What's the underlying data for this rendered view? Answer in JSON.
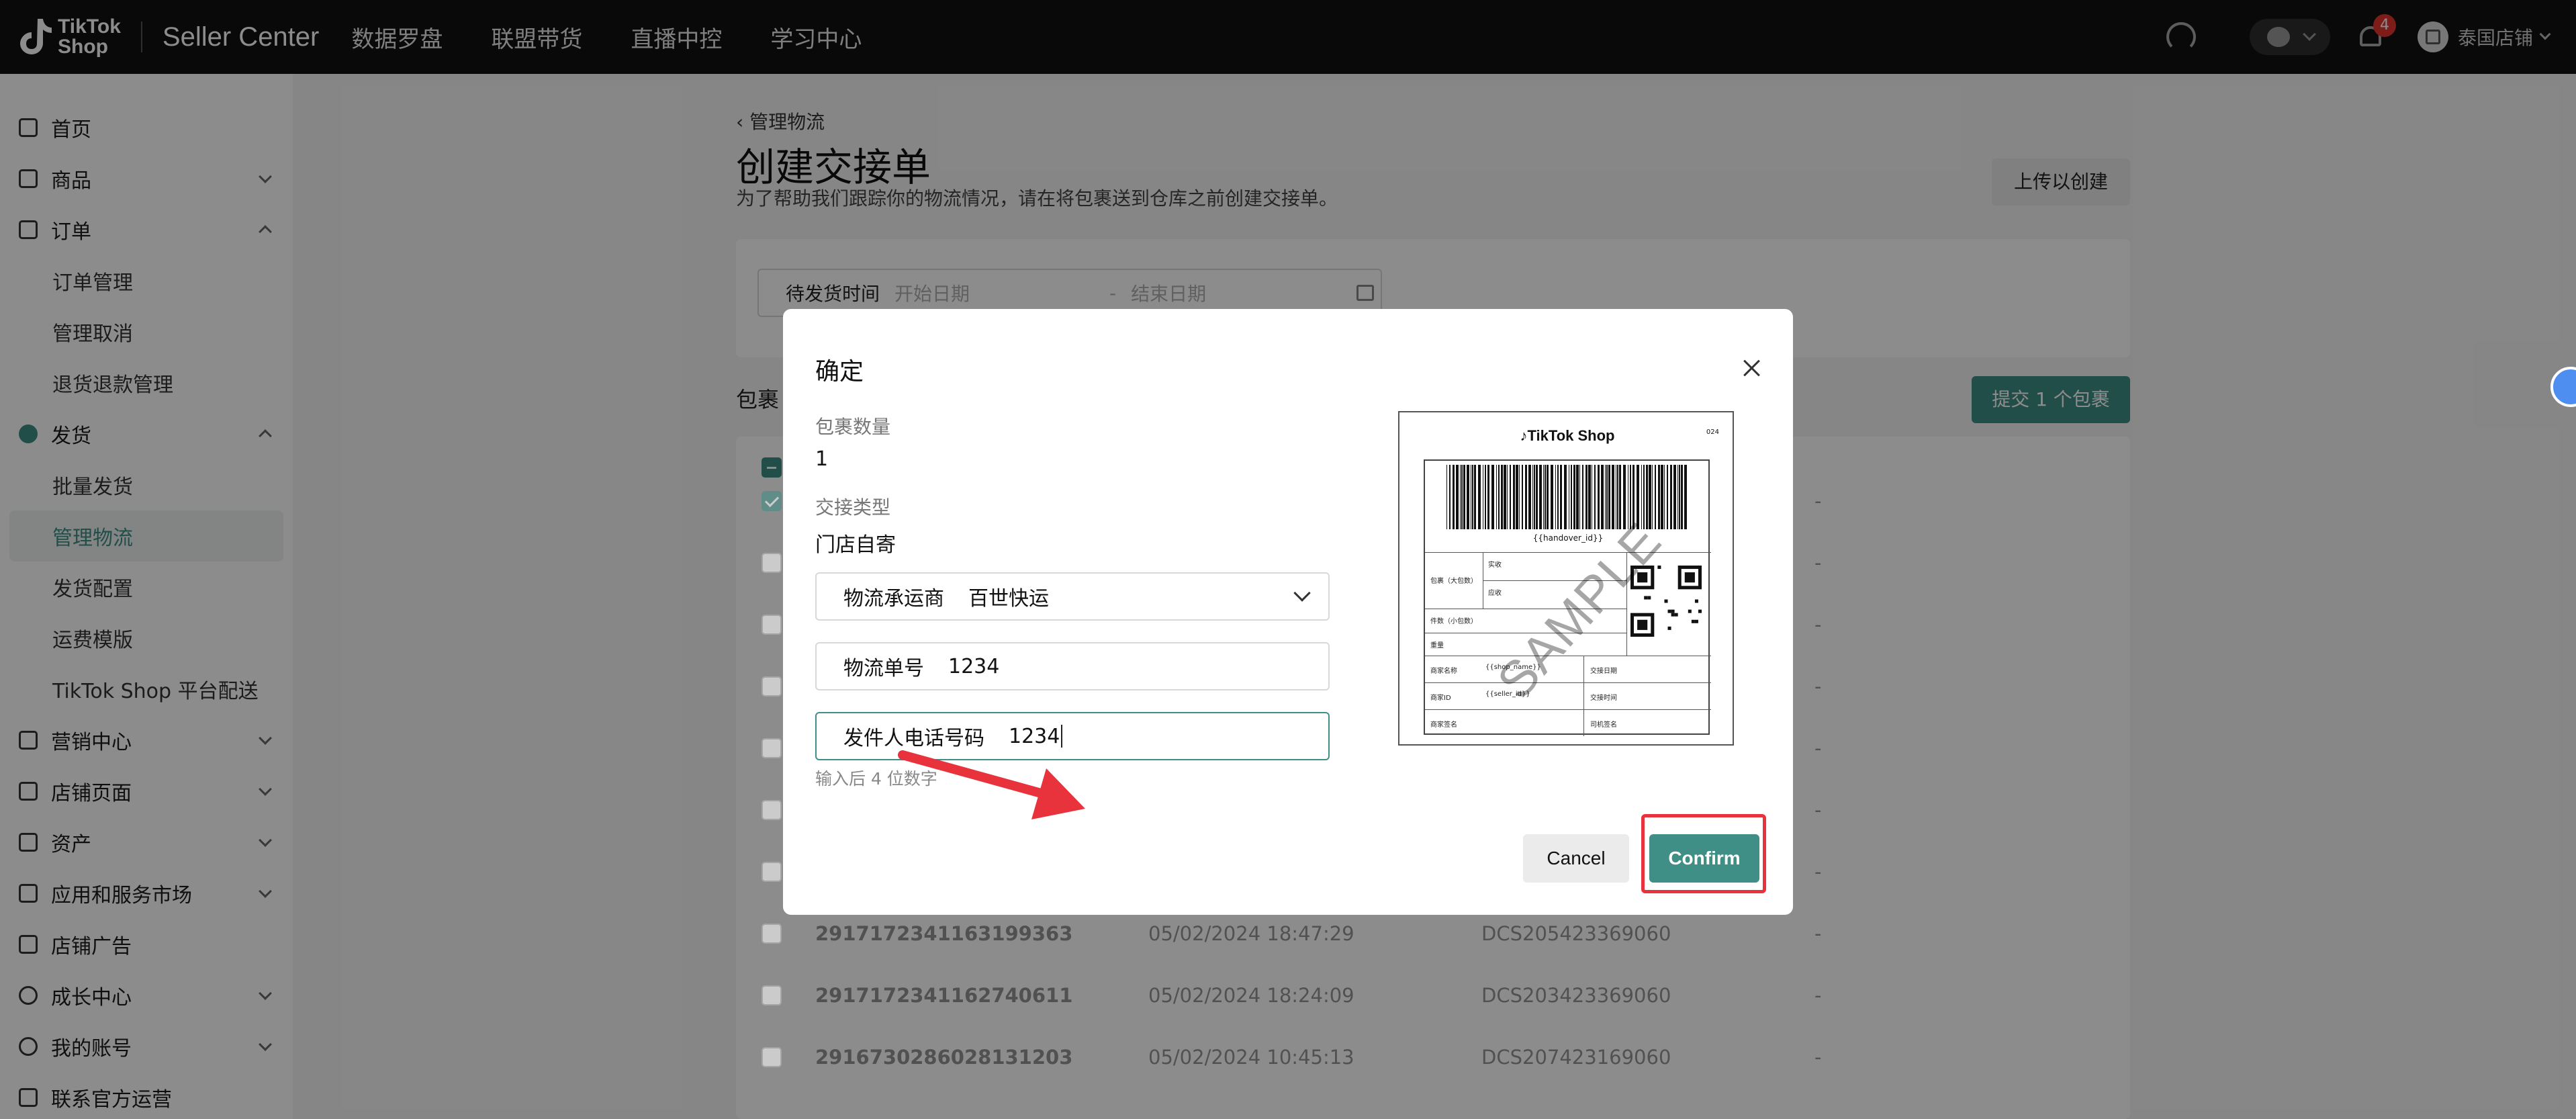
{
  "topbar": {
    "logo_line1": "TikTok",
    "logo_line2": "Shop",
    "product": "Seller Center",
    "nav": [
      "数据罗盘",
      "联盟带货",
      "直播中控",
      "学习中心"
    ],
    "notification_count": "4",
    "store_name": "泰国店铺"
  },
  "sidebar": {
    "items": [
      {
        "label": "首页",
        "icon": "home-icon",
        "level": 1
      },
      {
        "label": "商品",
        "icon": "product-icon",
        "level": 1,
        "chevron": "down"
      },
      {
        "label": "订单",
        "icon": "order-icon",
        "level": 1,
        "chevron": "up"
      },
      {
        "label": "订单管理",
        "level": 2
      },
      {
        "label": "管理取消",
        "level": 2
      },
      {
        "label": "退货退款管理",
        "level": 2
      },
      {
        "label": "发货",
        "icon": "truck-icon",
        "level": 1,
        "chevron": "up"
      },
      {
        "label": "批量发货",
        "level": 2
      },
      {
        "label": "管理物流",
        "level": 2,
        "active": true
      },
      {
        "label": "发货配置",
        "level": 2
      },
      {
        "label": "运费模版",
        "level": 2
      },
      {
        "label": "TikTok Shop 平台配送",
        "level": 2
      },
      {
        "label": "营销中心",
        "icon": "megaphone-icon",
        "level": 1,
        "chevron": "down"
      },
      {
        "label": "店铺页面",
        "icon": "store-page-icon",
        "level": 1,
        "chevron": "down"
      },
      {
        "label": "资产",
        "icon": "wallet-icon",
        "level": 1,
        "chevron": "down"
      },
      {
        "label": "应用和服务市场",
        "icon": "apps-icon",
        "level": 1,
        "chevron": "down"
      },
      {
        "label": "店铺广告",
        "icon": "ads-icon",
        "level": 1
      },
      {
        "label": "成长中心",
        "icon": "medal-icon",
        "level": 1,
        "chevron": "down"
      },
      {
        "label": "我的账号",
        "icon": "user-icon",
        "level": 1,
        "chevron": "down"
      },
      {
        "label": "联系官方运营",
        "icon": "contact-icon",
        "level": 1
      }
    ]
  },
  "page": {
    "breadcrumb": "管理物流",
    "title": "创建交接单",
    "subtitle": "为了帮助我们跟踪你的物流情况，请在将包裹送到仓库之前创建交接单。",
    "upload_button": "上传以创建",
    "filter_label": "待发货时间",
    "start_placeholder": "开始日期",
    "end_placeholder": "结束日期",
    "date_sep": "-",
    "list_label": "包裹",
    "submit_button": "提交 1 个包裹"
  },
  "table": {
    "rows": [
      {
        "id": "",
        "time": "",
        "tracking": "",
        "extra": "-",
        "checked": true
      },
      {
        "id": "",
        "time": "",
        "tracking": "",
        "extra": "-"
      },
      {
        "id": "",
        "time": "",
        "tracking": "",
        "extra": "-"
      },
      {
        "id": "",
        "time": "",
        "tracking": "",
        "extra": "-"
      },
      {
        "id": "",
        "time": "",
        "tracking": "",
        "extra": "-"
      },
      {
        "id": "",
        "time": "",
        "tracking": "",
        "extra": "-"
      },
      {
        "id": "",
        "time": "",
        "tracking": "",
        "extra": "-"
      },
      {
        "id": "2917172341163199363",
        "time": "05/02/2024 18:47:29",
        "tracking": "DCS205423369060",
        "extra": "-"
      },
      {
        "id": "2917172341162740611",
        "time": "05/02/2024 18:24:09",
        "tracking": "DCS203423369060",
        "extra": "-"
      },
      {
        "id": "2916730286028131203",
        "time": "05/02/2024 10:45:13",
        "tracking": "DCS207423169060",
        "extra": "-"
      }
    ]
  },
  "modal": {
    "title": "确定",
    "count_label": "包裹数量",
    "count_value": "1",
    "type_label": "交接类型",
    "type_value": "门店自寄",
    "carrier_label": "物流承运商",
    "carrier_value": "百世快运",
    "tracking_label": "物流单号",
    "tracking_value": "1234",
    "phone_label": "发件人电话号码",
    "phone_value": "1234",
    "hint": "输入后 4 位数字",
    "cancel": "Cancel",
    "confirm": "Confirm",
    "label_preview": {
      "brand": "TikTok Shop",
      "top_right_code": "024",
      "barcode_text": "{{handover_id}}",
      "watermark": "SAMPLE",
      "shop_name_field": "{{shop_name}}",
      "seller_id_field": "{{seller_id}}",
      "rows_left": [
        "包裹（大包数）",
        "件数（小包数）",
        "重量",
        "商家名称",
        "商家ID",
        "商家签名"
      ],
      "rows_right": [
        "交接日期",
        "交接时间",
        "司机签名"
      ],
      "mini_labels": [
        "实收",
        "应收"
      ]
    }
  },
  "colors": {
    "accent": "#3f8f86",
    "topbar": "#121212",
    "highlight_red": "#e8333c"
  }
}
